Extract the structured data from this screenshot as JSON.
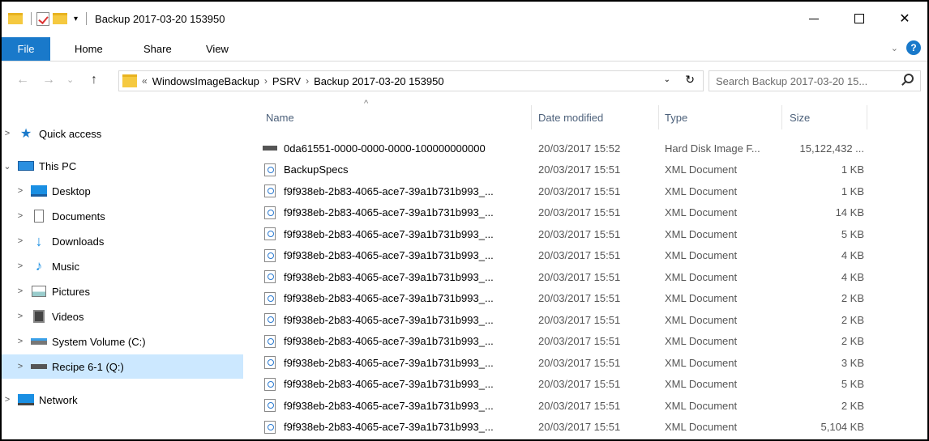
{
  "window": {
    "title": "Backup 2017-03-20 153950",
    "qat_arrow": "▾",
    "controls": {
      "close": "✕"
    }
  },
  "ribbon": {
    "tabs": [
      "File",
      "Home",
      "Share",
      "View"
    ],
    "chevron": "⌄",
    "help": "?"
  },
  "address": {
    "back": "←",
    "forward": "→",
    "recent": "⌄",
    "up": "↑",
    "overflow": "«",
    "crumbs": [
      "WindowsImageBackup",
      "PSRV",
      "Backup 2017-03-20 153950"
    ],
    "separator": "›",
    "dropdown": "⌄",
    "refresh": "↻"
  },
  "search": {
    "placeholder": "Search Backup 2017-03-20 15..."
  },
  "nav": {
    "items": [
      {
        "label": "Quick access",
        "icon": "star-icon",
        "expander": ">"
      },
      {
        "label": "This PC",
        "icon": "computer-icon",
        "expander": "⌄"
      },
      {
        "label": "Desktop",
        "icon": "desktop-icon",
        "expander": ">"
      },
      {
        "label": "Documents",
        "icon": "documents-icon",
        "expander": ">"
      },
      {
        "label": "Downloads",
        "icon": "downloads-icon",
        "expander": ">"
      },
      {
        "label": "Music",
        "icon": "music-icon",
        "expander": ">"
      },
      {
        "label": "Pictures",
        "icon": "pictures-icon",
        "expander": ">"
      },
      {
        "label": "Videos",
        "icon": "videos-icon",
        "expander": ">"
      },
      {
        "label": "System Volume (C:)",
        "icon": "system-drive-icon",
        "expander": ">"
      },
      {
        "label": "Recipe 6-1 (Q:)",
        "icon": "drive-icon",
        "expander": ">",
        "selected": true
      },
      {
        "label": "Network",
        "icon": "network-icon",
        "expander": ">"
      }
    ]
  },
  "columns": {
    "name": "Name",
    "date": "Date modified",
    "type": "Type",
    "size": "Size",
    "sort_indicator": "^"
  },
  "files": [
    {
      "name": "0da61551-0000-0000-0000-100000000000",
      "date": "20/03/2017 15:52",
      "type": "Hard Disk Image F...",
      "size": "15,122,432 ...",
      "icon": "vhd-icon"
    },
    {
      "name": "BackupSpecs",
      "date": "20/03/2017 15:51",
      "type": "XML Document",
      "size": "1 KB",
      "icon": "xml-icon"
    },
    {
      "name": "f9f938eb-2b83-4065-ace7-39a1b731b993_...",
      "date": "20/03/2017 15:51",
      "type": "XML Document",
      "size": "1 KB",
      "icon": "xml-icon"
    },
    {
      "name": "f9f938eb-2b83-4065-ace7-39a1b731b993_...",
      "date": "20/03/2017 15:51",
      "type": "XML Document",
      "size": "14 KB",
      "icon": "xml-icon"
    },
    {
      "name": "f9f938eb-2b83-4065-ace7-39a1b731b993_...",
      "date": "20/03/2017 15:51",
      "type": "XML Document",
      "size": "5 KB",
      "icon": "xml-icon"
    },
    {
      "name": "f9f938eb-2b83-4065-ace7-39a1b731b993_...",
      "date": "20/03/2017 15:51",
      "type": "XML Document",
      "size": "4 KB",
      "icon": "xml-icon"
    },
    {
      "name": "f9f938eb-2b83-4065-ace7-39a1b731b993_...",
      "date": "20/03/2017 15:51",
      "type": "XML Document",
      "size": "4 KB",
      "icon": "xml-icon"
    },
    {
      "name": "f9f938eb-2b83-4065-ace7-39a1b731b993_...",
      "date": "20/03/2017 15:51",
      "type": "XML Document",
      "size": "2 KB",
      "icon": "xml-icon"
    },
    {
      "name": "f9f938eb-2b83-4065-ace7-39a1b731b993_...",
      "date": "20/03/2017 15:51",
      "type": "XML Document",
      "size": "2 KB",
      "icon": "xml-icon"
    },
    {
      "name": "f9f938eb-2b83-4065-ace7-39a1b731b993_...",
      "date": "20/03/2017 15:51",
      "type": "XML Document",
      "size": "2 KB",
      "icon": "xml-icon"
    },
    {
      "name": "f9f938eb-2b83-4065-ace7-39a1b731b993_...",
      "date": "20/03/2017 15:51",
      "type": "XML Document",
      "size": "3 KB",
      "icon": "xml-icon"
    },
    {
      "name": "f9f938eb-2b83-4065-ace7-39a1b731b993_...",
      "date": "20/03/2017 15:51",
      "type": "XML Document",
      "size": "5 KB",
      "icon": "xml-icon"
    },
    {
      "name": "f9f938eb-2b83-4065-ace7-39a1b731b993_...",
      "date": "20/03/2017 15:51",
      "type": "XML Document",
      "size": "2 KB",
      "icon": "xml-icon"
    },
    {
      "name": "f9f938eb-2b83-4065-ace7-39a1b731b993_...",
      "date": "20/03/2017 15:51",
      "type": "XML Document",
      "size": "5,104 KB",
      "icon": "xml-icon"
    }
  ],
  "colors": {
    "accent": "#1979ca",
    "selected": "#cce8ff"
  }
}
